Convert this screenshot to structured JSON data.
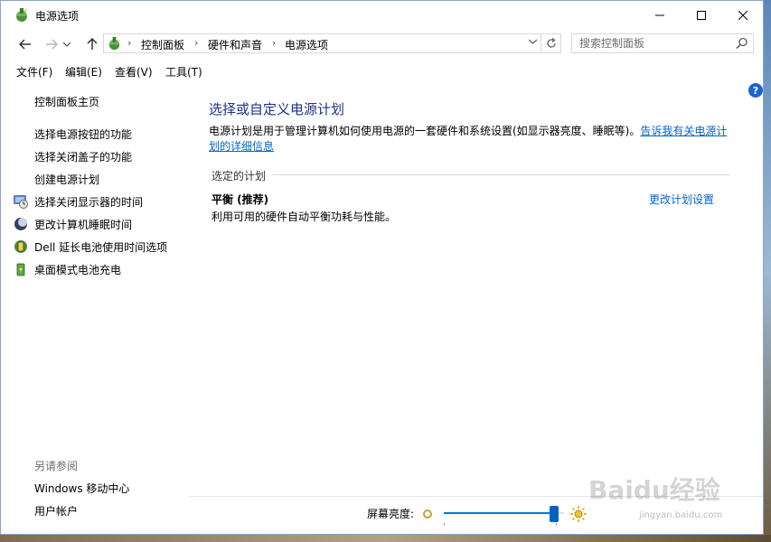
{
  "window": {
    "title": "电源选项"
  },
  "address": {
    "crumbs": [
      "控制面板",
      "硬件和声音",
      "电源选项"
    ]
  },
  "search": {
    "placeholder": "搜索控制面板"
  },
  "menu": [
    "文件(F)",
    "编辑(E)",
    "查看(V)",
    "工具(T)"
  ],
  "sidebar": {
    "home": "控制面板主页",
    "links": [
      "选择电源按钮的功能",
      "选择关闭盖子的功能",
      "创建电源计划",
      "选择关闭显示器的时间",
      "更改计算机睡眠时间",
      "Dell 延长电池使用时间选项",
      "桌面模式电池充电"
    ],
    "see_also_label": "另请参阅",
    "see_also": [
      "Windows 移动中心",
      "用户帐户"
    ]
  },
  "main": {
    "title": "选择或自定义电源计划",
    "description": "电源计划是用于管理计算机如何使用电源的一套硬件和系统设置(如显示器亮度、睡眠等)。",
    "description_link": "告诉我有关电源计划的详细信息",
    "section": "选定的计划",
    "plan_name": "平衡 (推荐)",
    "plan_desc": "利用可用的硬件自动平衡功耗与性能。",
    "change_plan": "更改计划设置"
  },
  "brightness": {
    "label": "屏幕亮度:",
    "level": 0.95
  },
  "watermark": {
    "text": "Baidu经验",
    "sub": "jingyan.baidu.com"
  },
  "colors": {
    "link": "#0066cc",
    "title": "#1e3287",
    "accent": "#0078d7"
  }
}
